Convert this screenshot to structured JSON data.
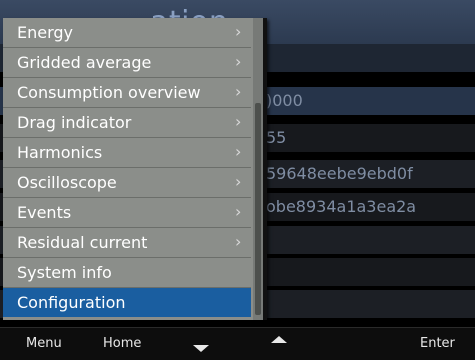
{
  "page": {
    "title_fragment": "ation"
  },
  "background_rows": [
    {
      "value": ""
    },
    {
      "value": ")000"
    },
    {
      "value": "55"
    },
    {
      "value": "59648eebe9ebd0f"
    },
    {
      "value": "obe8934a1a3ea2a"
    },
    {
      "value": ""
    },
    {
      "value": ""
    },
    {
      "value": ""
    }
  ],
  "menu": {
    "items": [
      {
        "label": "Energy",
        "has_submenu": true
      },
      {
        "label": "Gridded average",
        "has_submenu": true
      },
      {
        "label": "Consumption overview",
        "has_submenu": true
      },
      {
        "label": "Drag indicator",
        "has_submenu": true
      },
      {
        "label": "Harmonics",
        "has_submenu": true
      },
      {
        "label": "Oscilloscope",
        "has_submenu": true
      },
      {
        "label": "Events",
        "has_submenu": true
      },
      {
        "label": "Residual current",
        "has_submenu": true
      },
      {
        "label": "System info",
        "has_submenu": false
      },
      {
        "label": "Configuration",
        "has_submenu": false,
        "selected": true
      }
    ],
    "chevron": "›"
  },
  "softkeys": {
    "menu": "Menu",
    "home": "Home",
    "down": "down-arrow-icon",
    "up": "up-arrow-icon",
    "enter": "Enter"
  },
  "colors": {
    "selected": "#1a5ea0",
    "menu_bg": "#8b8e8a",
    "header": "#2c3a50"
  }
}
